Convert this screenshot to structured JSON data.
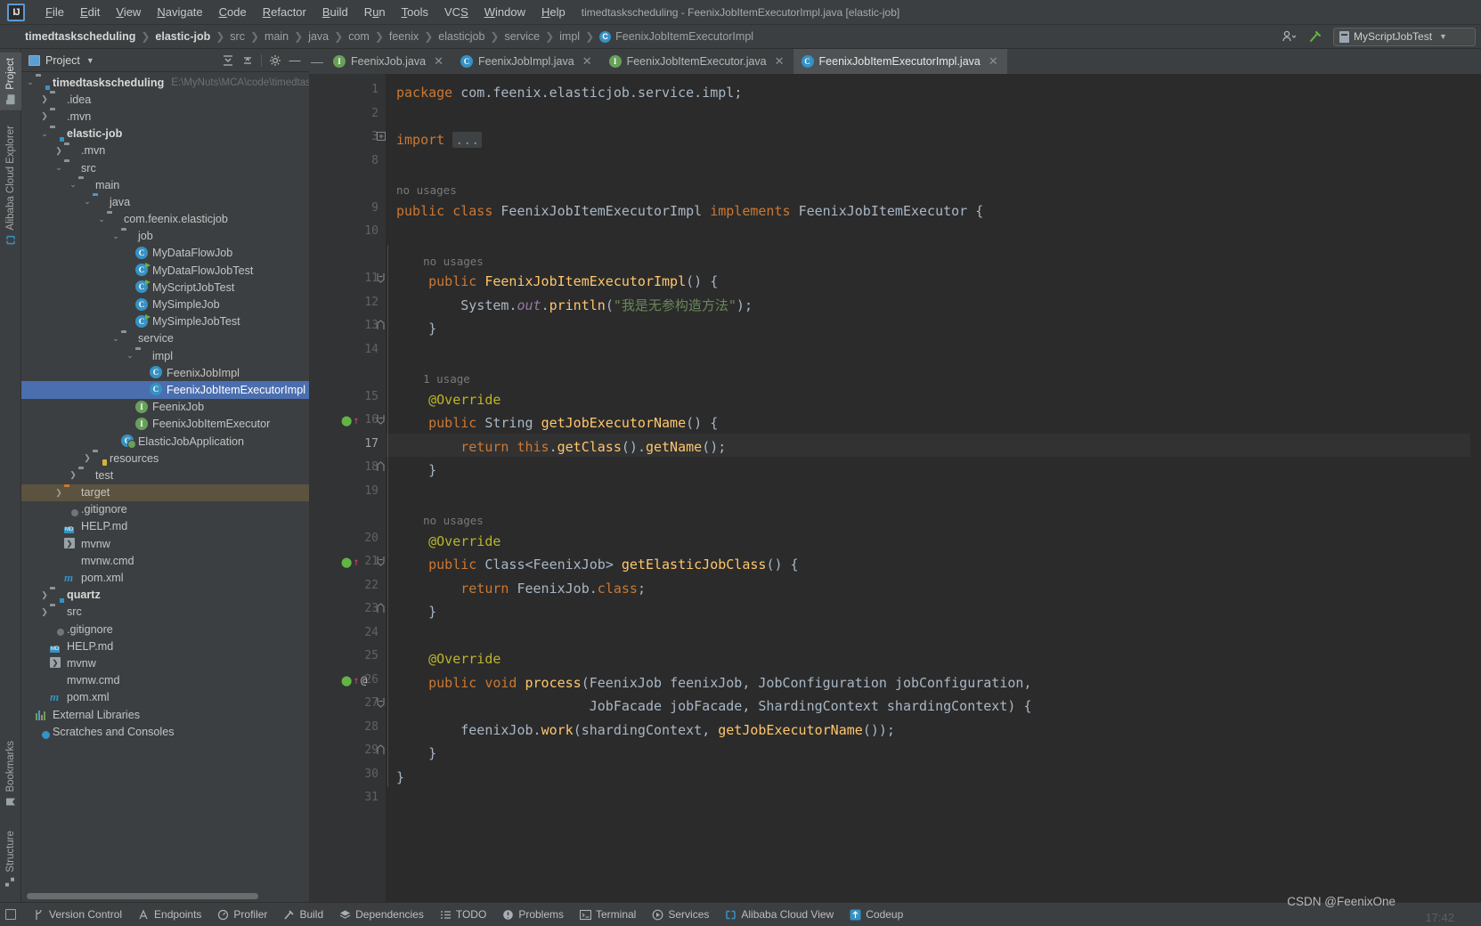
{
  "window": {
    "title": "timedtaskscheduling - FeenixJobItemExecutorImpl.java [elastic-job]",
    "logo": "IJ"
  },
  "menu": {
    "items": [
      "File",
      "Edit",
      "View",
      "Navigate",
      "Code",
      "Refactor",
      "Build",
      "Run",
      "Tools",
      "VCS",
      "Window",
      "Help"
    ]
  },
  "navbar": {
    "crumbs": [
      {
        "label": "timedtaskscheduling",
        "bold": true
      },
      {
        "label": "elastic-job",
        "bold": true
      },
      {
        "label": "src",
        "bold": false
      },
      {
        "label": "main",
        "bold": false
      },
      {
        "label": "java",
        "bold": false
      },
      {
        "label": "com",
        "bold": false
      },
      {
        "label": "feenix",
        "bold": false
      },
      {
        "label": "elasticjob",
        "bold": false
      },
      {
        "label": "service",
        "bold": false
      },
      {
        "label": "impl",
        "bold": false
      },
      {
        "label": "FeenixJobItemExecutorImpl",
        "bold": false,
        "icon": "class-icon"
      }
    ],
    "run_config": "MyScriptJobTest",
    "icons": [
      "user-avatar-icon",
      "build-hammer-icon"
    ]
  },
  "left_strip": {
    "top": [
      {
        "label": "Project",
        "icon": "project-folder-icon",
        "active": true
      },
      {
        "label": "Alibaba Cloud Explorer",
        "icon": "cloud-icon",
        "active": false
      }
    ],
    "bottom": [
      {
        "label": "Bookmarks",
        "icon": "bookmark-icon"
      },
      {
        "label": "Structure",
        "icon": "structure-icon"
      }
    ]
  },
  "project_panel": {
    "title": "Project",
    "actions": [
      "expand-all-icon",
      "collapse-all-icon",
      "settings-gear-icon",
      "hide-icon"
    ],
    "tree": [
      {
        "depth": 0,
        "arrow": "down",
        "icon": "module-icon",
        "label": "timedtaskscheduling",
        "bold": true,
        "path": "E:\\MyNuts\\MCA\\code\\timedtask"
      },
      {
        "depth": 1,
        "arrow": "right",
        "icon": "folder-icon",
        "label": ".idea"
      },
      {
        "depth": 1,
        "arrow": "right",
        "icon": "folder-icon",
        "label": ".mvn"
      },
      {
        "depth": 1,
        "arrow": "down",
        "icon": "module-icon",
        "label": "elastic-job",
        "bold": true
      },
      {
        "depth": 2,
        "arrow": "right",
        "icon": "folder-icon",
        "label": ".mvn"
      },
      {
        "depth": 2,
        "arrow": "down",
        "icon": "folder-icon",
        "label": "src"
      },
      {
        "depth": 3,
        "arrow": "down",
        "icon": "folder-icon",
        "label": "main"
      },
      {
        "depth": 4,
        "arrow": "down",
        "icon": "folder-source-icon",
        "label": "java"
      },
      {
        "depth": 5,
        "arrow": "down",
        "icon": "package-icon",
        "label": "com.feenix.elasticjob"
      },
      {
        "depth": 6,
        "arrow": "down",
        "icon": "package-icon",
        "label": "job"
      },
      {
        "depth": 7,
        "arrow": "none",
        "icon": "class-icon",
        "label": "MyDataFlowJob"
      },
      {
        "depth": 7,
        "arrow": "none",
        "icon": "class-test-icon",
        "label": "MyDataFlowJobTest"
      },
      {
        "depth": 7,
        "arrow": "none",
        "icon": "class-test-icon",
        "label": "MyScriptJobTest"
      },
      {
        "depth": 7,
        "arrow": "none",
        "icon": "class-icon",
        "label": "MySimpleJob"
      },
      {
        "depth": 7,
        "arrow": "none",
        "icon": "class-test-icon",
        "label": "MySimpleJobTest"
      },
      {
        "depth": 6,
        "arrow": "down",
        "icon": "package-icon",
        "label": "service"
      },
      {
        "depth": 7,
        "arrow": "down",
        "icon": "package-icon",
        "label": "impl"
      },
      {
        "depth": 8,
        "arrow": "none",
        "icon": "class-icon",
        "label": "FeenixJobImpl"
      },
      {
        "depth": 8,
        "arrow": "none",
        "icon": "class-icon",
        "label": "FeenixJobItemExecutorImpl",
        "selected": true
      },
      {
        "depth": 7,
        "arrow": "none",
        "icon": "interface-icon",
        "label": "FeenixJob"
      },
      {
        "depth": 7,
        "arrow": "none",
        "icon": "interface-icon",
        "label": "FeenixJobItemExecutor"
      },
      {
        "depth": 6,
        "arrow": "none",
        "icon": "spring-class-icon",
        "label": "ElasticJobApplication"
      },
      {
        "depth": 4,
        "arrow": "right",
        "icon": "folder-resources-icon",
        "label": "resources"
      },
      {
        "depth": 3,
        "arrow": "right",
        "icon": "folder-icon",
        "label": "test"
      },
      {
        "depth": 2,
        "arrow": "right",
        "icon": "folder-target-icon",
        "label": "target",
        "highlight": true
      },
      {
        "depth": 2,
        "arrow": "none",
        "icon": "gitignore-icon",
        "label": ".gitignore"
      },
      {
        "depth": 2,
        "arrow": "none",
        "icon": "markdown-icon",
        "label": "HELP.md"
      },
      {
        "depth": 2,
        "arrow": "none",
        "icon": "shell-script-icon",
        "label": "mvnw"
      },
      {
        "depth": 2,
        "arrow": "none",
        "icon": "cmd-file-icon",
        "label": "mvnw.cmd"
      },
      {
        "depth": 2,
        "arrow": "none",
        "icon": "maven-icon",
        "label": "pom.xml"
      },
      {
        "depth": 1,
        "arrow": "right",
        "icon": "module-icon",
        "label": "quartz",
        "bold": true
      },
      {
        "depth": 1,
        "arrow": "right",
        "icon": "folder-icon",
        "label": "src"
      },
      {
        "depth": 1,
        "arrow": "none",
        "icon": "gitignore-icon",
        "label": ".gitignore"
      },
      {
        "depth": 1,
        "arrow": "none",
        "icon": "markdown-icon",
        "label": "HELP.md"
      },
      {
        "depth": 1,
        "arrow": "none",
        "icon": "shell-script-icon",
        "label": "mvnw"
      },
      {
        "depth": 1,
        "arrow": "none",
        "icon": "cmd-file-icon",
        "label": "mvnw.cmd"
      },
      {
        "depth": 1,
        "arrow": "none",
        "icon": "maven-icon",
        "label": "pom.xml"
      },
      {
        "depth": 0,
        "arrow": "none",
        "icon": "external-libraries-icon",
        "label": "External Libraries"
      },
      {
        "depth": 0,
        "arrow": "none",
        "icon": "scratches-icon",
        "label": "Scratches and Consoles"
      }
    ]
  },
  "editor": {
    "tabs": [
      {
        "label": "FeenixJob.java",
        "icon": "interface-icon",
        "active": false
      },
      {
        "label": "FeenixJobImpl.java",
        "icon": "class-icon",
        "active": false
      },
      {
        "label": "FeenixJobItemExecutor.java",
        "icon": "interface-icon",
        "active": false
      },
      {
        "label": "FeenixJobItemExecutorImpl.java",
        "icon": "class-icon",
        "active": true
      }
    ],
    "line_numbers": [
      "1",
      "2",
      "3",
      "8",
      "9",
      "10",
      "11",
      "12",
      "13",
      "14",
      "15",
      "16",
      "17",
      "18",
      "19",
      "20",
      "21",
      "22",
      "23",
      "24",
      "25",
      "26",
      "27",
      "28",
      "29",
      "30",
      "31"
    ],
    "code_lines": [
      {
        "num": "1",
        "text": "package com.feenix.elasticjob.service.impl;"
      },
      {
        "num": "3",
        "text": "import ..."
      },
      {
        "num": "9",
        "text": "public class FeenixJobItemExecutorImpl implements FeenixJobItemExecutor {",
        "hint": "no usages"
      },
      {
        "num": "11",
        "text": "    public FeenixJobItemExecutorImpl() {",
        "hint": "no usages"
      },
      {
        "num": "12",
        "text": "        System.out.println(\"我是无参构造方法\");"
      },
      {
        "num": "13",
        "text": "    }"
      },
      {
        "num": "15",
        "text": "    @Override",
        "hint": "1 usage"
      },
      {
        "num": "16",
        "text": "    public String getJobExecutorName() {"
      },
      {
        "num": "17",
        "text": "        return this.getClass().getName();"
      },
      {
        "num": "18",
        "text": "    }"
      },
      {
        "num": "20",
        "text": "    @Override",
        "hint": "no usages"
      },
      {
        "num": "21",
        "text": "    public Class<FeenixJob> getElasticJobClass() {"
      },
      {
        "num": "22",
        "text": "        return FeenixJob.class;"
      },
      {
        "num": "23",
        "text": "    }"
      },
      {
        "num": "25",
        "text": "    @Override"
      },
      {
        "num": "26",
        "text": "    public void process(FeenixJob feenixJob, JobConfiguration jobConfiguration,"
      },
      {
        "num": "27",
        "text": "                        JobFacade jobFacade, ShardingContext shardingContext) {"
      },
      {
        "num": "28",
        "text": "        feenixJob.work(shardingContext, getJobExecutorName());"
      },
      {
        "num": "29",
        "text": "    }"
      },
      {
        "num": "30",
        "text": "}"
      }
    ],
    "string_literal": "我是无参构造方法",
    "caret_line": 17
  },
  "status_bar": {
    "buttons": [
      {
        "label": "Version Control",
        "icon": "branch-icon"
      },
      {
        "label": "Endpoints",
        "icon": "endpoints-icon"
      },
      {
        "label": "Profiler",
        "icon": "profiler-icon"
      },
      {
        "label": "Build",
        "icon": "hammer-icon"
      },
      {
        "label": "Dependencies",
        "icon": "layers-icon"
      },
      {
        "label": "TODO",
        "icon": "list-icon"
      },
      {
        "label": "Problems",
        "icon": "warning-icon"
      },
      {
        "label": "Terminal",
        "icon": "terminal-icon"
      },
      {
        "label": "Services",
        "icon": "services-icon"
      },
      {
        "label": "Alibaba Cloud View",
        "icon": "cloud-icon"
      },
      {
        "label": "Codeup",
        "icon": "codeup-icon"
      }
    ],
    "watermark": "CSDN @FeenixOne",
    "clock": "17:42"
  },
  "colors": {
    "accent": "#4b6eaf",
    "keyword": "#cc7832",
    "string": "#6a8759",
    "annotation": "#bbb529",
    "method": "#ffc66d",
    "text": "#a9b7c6",
    "editor_bg": "#2b2b2b",
    "panel_bg": "#3c3f41"
  }
}
